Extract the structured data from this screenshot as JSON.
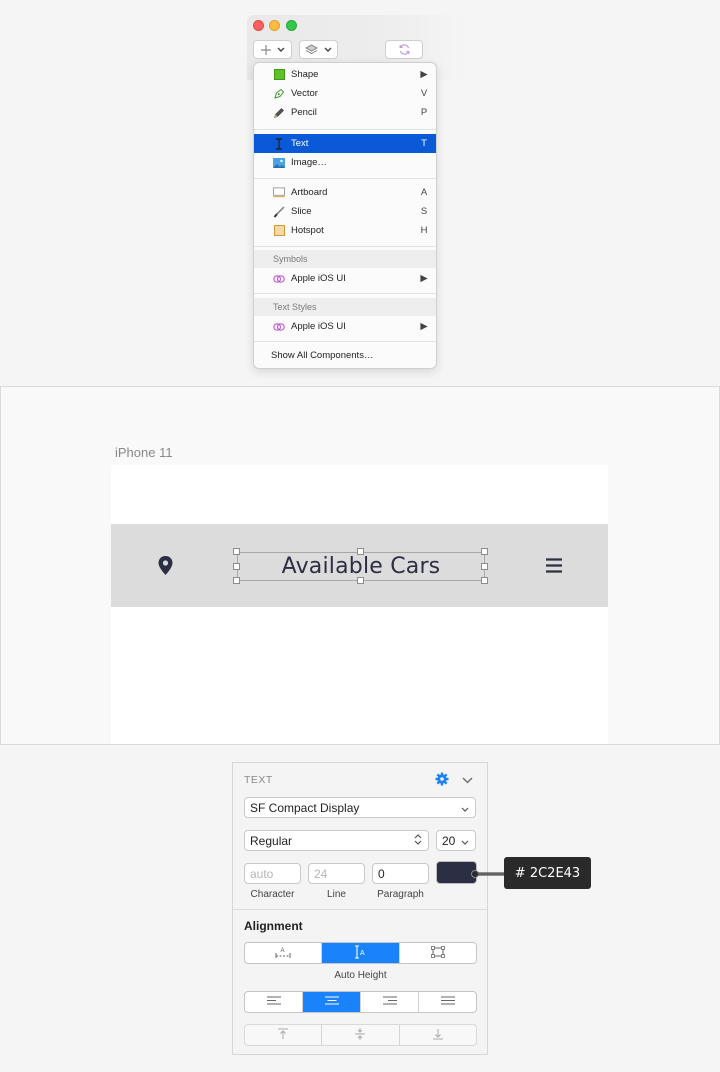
{
  "insert_menu": {
    "items_group1": [
      {
        "label": "Shape",
        "shortcut": "",
        "has_submenu": true,
        "icon": "shape-icon"
      },
      {
        "label": "Vector",
        "shortcut": "V",
        "has_submenu": false,
        "icon": "vector-pen-icon"
      },
      {
        "label": "Pencil",
        "shortcut": "P",
        "has_submenu": false,
        "icon": "pencil-icon"
      }
    ],
    "items_group2": [
      {
        "label": "Text",
        "shortcut": "T",
        "selected": true,
        "icon": "text-cursor-icon"
      },
      {
        "label": "Image…",
        "shortcut": "",
        "selected": false,
        "icon": "image-icon"
      }
    ],
    "items_group3": [
      {
        "label": "Artboard",
        "shortcut": "A",
        "icon": "artboard-icon"
      },
      {
        "label": "Slice",
        "shortcut": "S",
        "icon": "slice-knife-icon"
      },
      {
        "label": "Hotspot",
        "shortcut": "H",
        "icon": "hotspot-icon"
      }
    ],
    "symbols_header": "Symbols",
    "symbols_item": "Apple iOS UI",
    "text_styles_header": "Text Styles",
    "text_styles_item": "Apple iOS UI",
    "show_all": "Show All Components…",
    "submenu_arrow": "▶"
  },
  "canvas": {
    "artboard_name": "iPhone 11",
    "nav_title": "Available Cars",
    "left_icon": "location-pin-icon",
    "right_icon": "hamburger-menu-icon"
  },
  "inspector": {
    "section_title": "TEXT",
    "font_family": "SF Compact Display",
    "font_weight": "Regular",
    "font_size": "20",
    "character_placeholder": "auto",
    "line_placeholder": "24",
    "paragraph_value": "0",
    "character_label": "Character",
    "line_label": "Line",
    "paragraph_label": "Paragraph",
    "color_hex": "# 2C2E43",
    "alignment_label": "Alignment",
    "auto_height_label": "Auto Height",
    "text_color": "#2c2e43",
    "accent_color": "#1a82fb"
  }
}
